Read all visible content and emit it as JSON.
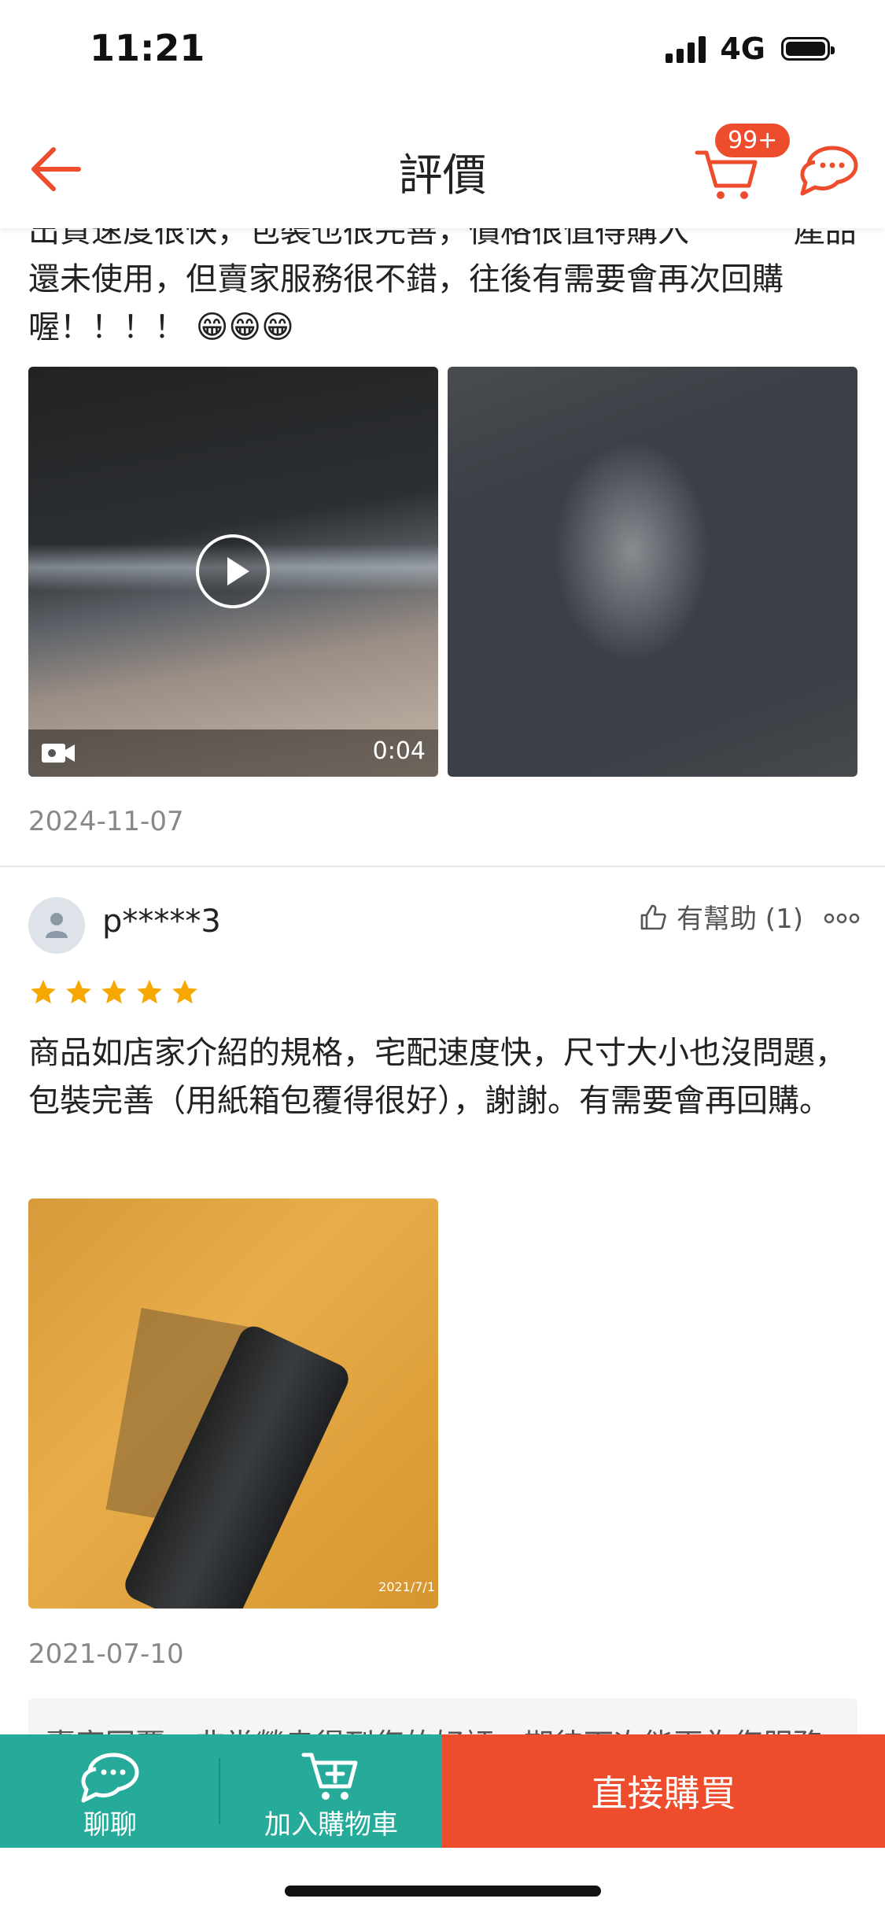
{
  "status_bar": {
    "time": "11:21",
    "network": "4G"
  },
  "header": {
    "title": "評價",
    "cart_badge": "99+"
  },
  "review1": {
    "text": "出貨速度很快，包裝也很完善，價格很值得購入 　　　產品還未使用，但賣家服務很不錯，往後有需要會再次回購喔！！！！ 😁😁😁",
    "video_duration": "0:04",
    "date": "2024-11-07"
  },
  "review2": {
    "username": "p*****3",
    "helpful": "有幫助 (1)",
    "rating": 5,
    "text": "商品如店家介紹的規格，宅配速度快，尺寸大小也沒問題，包裝完善（用紙箱包覆得很好），謝謝。有需要會再回購。",
    "photo_watermark": "2021/7/1",
    "date": "2021-07-10",
    "seller_reply": "賣家回覆：非常榮幸得到您的好評，期待下次能再為您服務"
  },
  "bottom_bar": {
    "chat_label": "聊聊",
    "add_to_cart_label": "加入購物車",
    "buy_now_label": "直接購買"
  },
  "colors": {
    "accent": "#ee4d2d",
    "teal": "#26aa99",
    "star": "#f6a700"
  }
}
